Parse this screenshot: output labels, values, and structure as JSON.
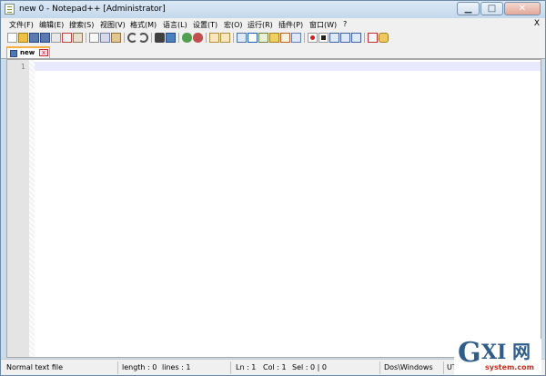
{
  "window": {
    "title": "new  0 - Notepad++ [Administrator]",
    "controls": {
      "minimize": "▁",
      "maximize": "□",
      "close": "✕"
    }
  },
  "menu": {
    "items": [
      "文件(F)",
      "编辑(E)",
      "搜索(S)",
      "视图(V)",
      "格式(M)",
      "语言(L)",
      "设置(T)",
      "宏(O)",
      "运行(R)",
      "插件(P)",
      "窗口(W)",
      "?"
    ],
    "close_label": "X"
  },
  "toolbar": {
    "icons": [
      "new-file",
      "open-file",
      "save",
      "save-all",
      "close",
      "close-all",
      "print",
      "cut",
      "copy",
      "paste",
      "undo",
      "redo",
      "find",
      "replace",
      "zoom-in",
      "zoom-out",
      "sync-vertical",
      "sync-horizontal",
      "word-wrap",
      "show-all-chars",
      "indent-guide",
      "user-language",
      "doc-map",
      "function-list",
      "record-macro",
      "stop-record",
      "play-macro",
      "run-macro-multiple",
      "save-macro",
      "spell-check",
      "plugin"
    ]
  },
  "tab": {
    "label": "new"
  },
  "editor": {
    "line_numbers": [
      "1"
    ]
  },
  "status": {
    "file_type": "Normal text file",
    "length": "length : 0",
    "lines": "lines : 1",
    "ln": "Ln : 1",
    "col": "Col : 1",
    "sel": "Sel : 0 | 0",
    "eol": "Dos\\Windows",
    "encoding": "UT"
  },
  "watermark": {
    "g": "G",
    "xi": "XI",
    "cn": "网",
    "url": "system.com"
  },
  "colors": {
    "accent": "#f8b040",
    "title_bar": "#c4d8ec",
    "current_line": "#e8e8ff"
  }
}
